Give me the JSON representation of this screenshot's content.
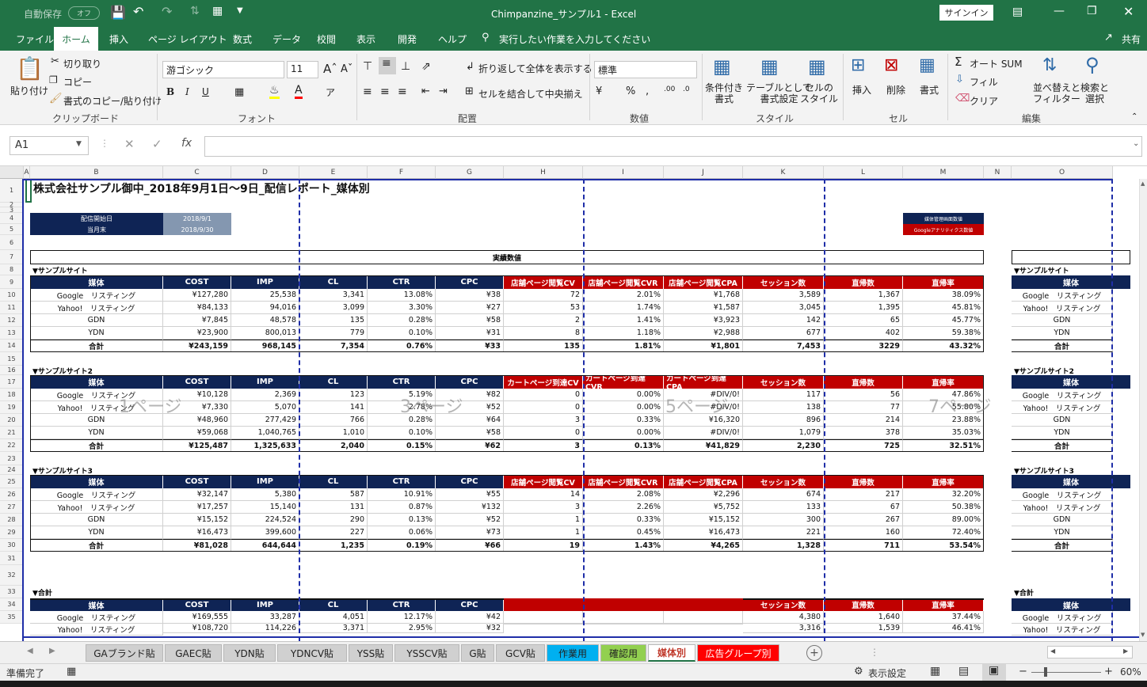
{
  "title": {
    "autosave": "自動保存",
    "toggle": "オフ",
    "doc": "Chimpanzine_サンプル1 - Excel",
    "signin": "サインイン"
  },
  "tabs": [
    "ファイル",
    "ホーム",
    "挿入",
    "ページ レイアウト",
    "数式",
    "データ",
    "校閲",
    "表示",
    "開発",
    "ヘルプ"
  ],
  "tellme": "実行したい作業を入力してください",
  "share": "共有",
  "ribbon": {
    "paste": "貼り付け",
    "cut": "切り取り",
    "copy": "コピー",
    "fmtpaint": "書式のコピー/貼り付け",
    "g_clip": "クリップボード",
    "font": "游ゴシック",
    "size": "11",
    "g_font": "フォント",
    "wrap": "折り返して全体を表示する",
    "merge": "セルを結合して中央揃え",
    "g_align": "配置",
    "numfmt": "標準",
    "g_num": "数値",
    "cond": "条件付き\n書式",
    "astable": "テーブルとして\n書式設定",
    "cellstyle": "セルの\nスタイル",
    "g_style": "スタイル",
    "ins": "挿入",
    "del": "削除",
    "fmt": "書式",
    "g_cell": "セル",
    "autosum": "オート SUM",
    "fill": "フィル",
    "clear": "クリア",
    "sort": "並べ替えと\nフィルター",
    "find": "検索と\n選択",
    "g_edit": "編集"
  },
  "namebox": "A1",
  "cols": [
    "A",
    "B",
    "C",
    "D",
    "E",
    "F",
    "G",
    "H",
    "I",
    "J",
    "K",
    "L",
    "M",
    "N",
    "O"
  ],
  "sheet": {
    "title": "株式会社サンプル御中_2018年9月1日～9日_配信レポート_媒体別",
    "start_lbl": "配信開始日",
    "start_val": "2018/9/1",
    "end_lbl": "当月末",
    "end_val": "2018/9/30",
    "legend1": "媒体管理画面数値",
    "legend2": "Googleアナリティクス数値",
    "banner": "実績数値",
    "wm": [
      "1ページ",
      "3ページ",
      "5ページ",
      "7ページ"
    ],
    "right_label": "媒体",
    "sections": [
      {
        "name": "▼サンプルサイト",
        "heads": [
          "媒体",
          "COST",
          "IMP",
          "CL",
          "CTR",
          "CPC",
          "店舗ページ閲覧CV",
          "店舗ページ閲覧CVR",
          "店舗ページ閲覧CPA",
          "セッション数",
          "直帰数",
          "直帰率"
        ],
        "rows": [
          [
            "Google　リスティング",
            "¥127,280",
            "25,538",
            "3,341",
            "13.08%",
            "¥38",
            "72",
            "2.01%",
            "¥1,768",
            "3,589",
            "1,367",
            "38.09%"
          ],
          [
            "Yahoo!　リスティング",
            "¥84,133",
            "94,016",
            "3,099",
            "3.30%",
            "¥27",
            "53",
            "1.74%",
            "¥1,587",
            "3,045",
            "1,395",
            "45.81%"
          ],
          [
            "GDN",
            "¥7,845",
            "48,578",
            "135",
            "0.28%",
            "¥58",
            "2",
            "1.41%",
            "¥3,923",
            "142",
            "65",
            "45.77%"
          ],
          [
            "YDN",
            "¥23,900",
            "800,013",
            "779",
            "0.10%",
            "¥31",
            "8",
            "1.18%",
            "¥2,988",
            "677",
            "402",
            "59.38%"
          ],
          [
            "合計",
            "¥243,159",
            "968,145",
            "7,354",
            "0.76%",
            "¥33",
            "135",
            "1.81%",
            "¥1,801",
            "7,453",
            "3229",
            "43.32%"
          ]
        ]
      },
      {
        "name": "▼サンプルサイト2",
        "heads": [
          "媒体",
          "COST",
          "IMP",
          "CL",
          "CTR",
          "CPC",
          "カートページ到達CV",
          "カートページ到達CVR",
          "カートページ到達CPA",
          "セッション数",
          "直帰数",
          "直帰率"
        ],
        "rows": [
          [
            "Google　リスティング",
            "¥10,128",
            "2,369",
            "123",
            "5.19%",
            "¥82",
            "0",
            "0.00%",
            "#DIV/0!",
            "117",
            "56",
            "47.86%"
          ],
          [
            "Yahoo!　リスティング",
            "¥7,330",
            "5,070",
            "141",
            "2.78%",
            "¥52",
            "0",
            "0.00%",
            "#DIV/0!",
            "138",
            "77",
            "55.80%"
          ],
          [
            "GDN",
            "¥48,960",
            "277,429",
            "766",
            "0.28%",
            "¥64",
            "3",
            "0.33%",
            "¥16,320",
            "896",
            "214",
            "23.88%"
          ],
          [
            "YDN",
            "¥59,068",
            "1,040,765",
            "1,010",
            "0.10%",
            "¥58",
            "0",
            "0.00%",
            "#DIV/0!",
            "1,079",
            "378",
            "35.03%"
          ],
          [
            "合計",
            "¥125,487",
            "1,325,633",
            "2,040",
            "0.15%",
            "¥62",
            "3",
            "0.13%",
            "¥41,829",
            "2,230",
            "725",
            "32.51%"
          ]
        ]
      },
      {
        "name": "▼サンプルサイト3",
        "heads": [
          "媒体",
          "COST",
          "IMP",
          "CL",
          "CTR",
          "CPC",
          "店舗ページ閲覧CV",
          "店舗ページ閲覧CVR",
          "店舗ページ閲覧CPA",
          "セッション数",
          "直帰数",
          "直帰率"
        ],
        "rows": [
          [
            "Google　リスティング",
            "¥32,147",
            "5,380",
            "587",
            "10.91%",
            "¥55",
            "14",
            "2.08%",
            "¥2,296",
            "674",
            "217",
            "32.20%"
          ],
          [
            "Yahoo!　リスティング",
            "¥17,257",
            "15,140",
            "131",
            "0.87%",
            "¥132",
            "3",
            "2.26%",
            "¥5,752",
            "133",
            "67",
            "50.38%"
          ],
          [
            "GDN",
            "¥15,152",
            "224,524",
            "290",
            "0.13%",
            "¥52",
            "1",
            "0.33%",
            "¥15,152",
            "300",
            "267",
            "89.00%"
          ],
          [
            "YDN",
            "¥16,473",
            "399,600",
            "227",
            "0.06%",
            "¥73",
            "1",
            "0.45%",
            "¥16,473",
            "221",
            "160",
            "72.40%"
          ],
          [
            "合計",
            "¥81,028",
            "644,644",
            "1,235",
            "0.19%",
            "¥66",
            "19",
            "1.43%",
            "¥4,265",
            "1,328",
            "711",
            "53.54%"
          ]
        ]
      },
      {
        "name": "▼合計",
        "heads": [
          "媒体",
          "COST",
          "IMP",
          "CL",
          "CTR",
          "CPC",
          "",
          "",
          "",
          "セッション数",
          "直帰数",
          "直帰率"
        ],
        "rows": [
          [
            "Google　リスティング",
            "¥169,555",
            "33,287",
            "4,051",
            "12.17%",
            "¥42",
            "",
            "",
            "",
            "4,380",
            "1,640",
            "37.44%"
          ],
          [
            "Yahoo!　リスティング",
            "¥108,720",
            "114,226",
            "3,371",
            "2.95%",
            "¥32",
            "",
            "",
            "",
            "3,316",
            "1,539",
            "46.41%"
          ]
        ]
      }
    ]
  },
  "sheettabs": [
    {
      "name": "GAブランド貼",
      "bg": "#d0d0d0",
      "fg": "#222"
    },
    {
      "name": "GAEC貼",
      "bg": "#d0d0d0",
      "fg": "#222"
    },
    {
      "name": "YDN貼",
      "bg": "#d0d0d0",
      "fg": "#222"
    },
    {
      "name": "YDNCV貼",
      "bg": "#d0d0d0",
      "fg": "#222"
    },
    {
      "name": "YSS貼",
      "bg": "#d0d0d0",
      "fg": "#222"
    },
    {
      "name": "YSSCV貼",
      "bg": "#d0d0d0",
      "fg": "#222"
    },
    {
      "name": "G貼",
      "bg": "#d0d0d0",
      "fg": "#222"
    },
    {
      "name": "GCV貼",
      "bg": "#d0d0d0",
      "fg": "#222"
    },
    {
      "name": "作業用",
      "bg": "#00b0f0",
      "fg": "#222"
    },
    {
      "name": "確認用",
      "bg": "#92d050",
      "fg": "#222"
    },
    {
      "name": "媒体別",
      "bg": "#ffffff",
      "fg": "#c0392b"
    },
    {
      "name": "広告グループ別",
      "bg": "#ff0000",
      "fg": "#ffffff"
    }
  ],
  "status": {
    "ready": "準備完了",
    "display": "表示設定",
    "zoom": "60%"
  }
}
